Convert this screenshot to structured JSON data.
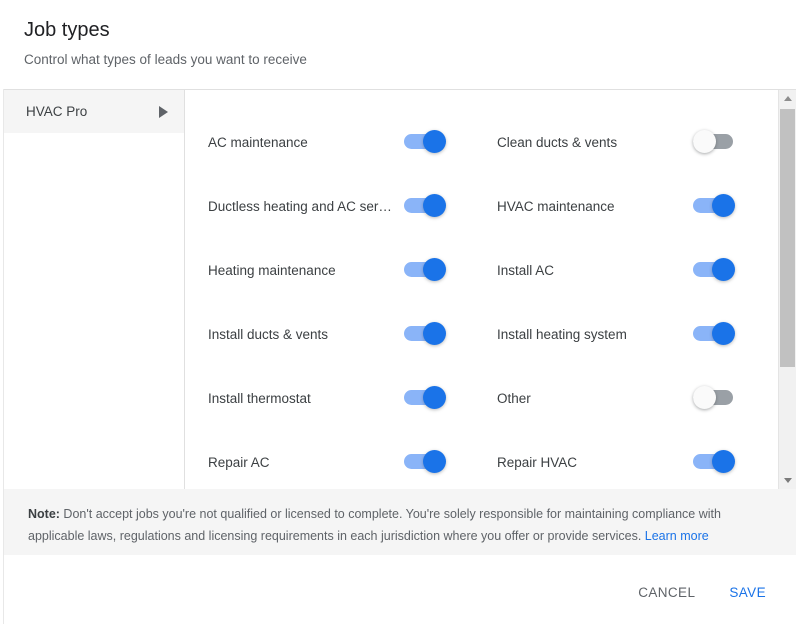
{
  "dialog": {
    "title": "Job types",
    "subtitle": "Control what types of leads you want to receive"
  },
  "sidebar": {
    "items": [
      {
        "label": "HVAC Pro",
        "selected": true,
        "caret": "caret-right-icon"
      }
    ]
  },
  "content": {
    "rows": [
      {
        "left": {
          "label": "AC maintenance",
          "state": "on"
        },
        "right": {
          "label": "Clean ducts & vents",
          "state": "off"
        }
      },
      {
        "left": {
          "label": "Ductless heating and AC ser…",
          "state": "on"
        },
        "right": {
          "label": "HVAC maintenance",
          "state": "on"
        }
      },
      {
        "left": {
          "label": "Heating maintenance",
          "state": "on"
        },
        "right": {
          "label": "Install AC",
          "state": "on"
        }
      },
      {
        "left": {
          "label": "Install ducts & vents",
          "state": "on"
        },
        "right": {
          "label": "Install heating system",
          "state": "on"
        }
      },
      {
        "left": {
          "label": "Install thermostat",
          "state": "on"
        },
        "right": {
          "label": "Other",
          "state": "off"
        }
      },
      {
        "left": {
          "label": "Repair AC",
          "state": "on"
        },
        "right": {
          "label": "Repair HVAC",
          "state": "on"
        }
      }
    ]
  },
  "scrollbar": {
    "up_arrow": "scroll-up-arrow-icon",
    "down_arrow": "scroll-down-arrow-icon",
    "thumb_position_percent": 0
  },
  "note": {
    "label": "Note:",
    "text": " Don't accept jobs you're not qualified or licensed to complete. You're solely responsible for maintaining compliance with applicable laws, regulations and licensing requirements in each jurisdiction where you offer or provide services. ",
    "link": "Learn more"
  },
  "footer": {
    "cancel_label": "CANCEL",
    "save_label": "SAVE"
  },
  "colors": {
    "accent_blue": "#1a73e8",
    "toggle_on_track": "#8ab4f8",
    "toggle_off_track": "#9aa0a6",
    "text_primary": "#3c4043",
    "text_secondary": "#5f6368",
    "note_background": "#f5f5f5",
    "selected_background": "#f5f5f5"
  }
}
